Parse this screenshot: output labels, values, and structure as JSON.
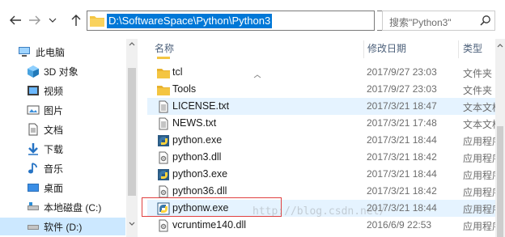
{
  "address": {
    "path": "D:\\SoftwareSpace\\Python\\Python3",
    "search_placeholder": "搜索\"Python3\""
  },
  "navigation": {
    "items": [
      {
        "label": "此电脑",
        "icon": "pc-icon"
      },
      {
        "label": "3D 对象",
        "icon": "3d-objects-icon"
      },
      {
        "label": "视频",
        "icon": "video-icon"
      },
      {
        "label": "图片",
        "icon": "pictures-icon"
      },
      {
        "label": "文档",
        "icon": "documents-icon"
      },
      {
        "label": "下载",
        "icon": "download-icon"
      },
      {
        "label": "音乐",
        "icon": "music-icon"
      },
      {
        "label": "桌面",
        "icon": "desktop-icon"
      },
      {
        "label": "本地磁盘 (C:)",
        "icon": "drive-icon"
      },
      {
        "label": "软件 (D:)",
        "icon": "drive-icon"
      }
    ]
  },
  "columns": {
    "name": "名称",
    "date": "修改日期",
    "type": "类型"
  },
  "files": [
    {
      "name": "",
      "date": "",
      "type": "",
      "icon": "folder-icon"
    },
    {
      "name": "tcl",
      "date": "2017/9/27 23:03",
      "type": "文件夹",
      "icon": "folder-icon"
    },
    {
      "name": "Tools",
      "date": "2017/9/27 23:03",
      "type": "文件夹",
      "icon": "folder-icon"
    },
    {
      "name": "LICENSE.txt",
      "date": "2017/3/21 18:47",
      "type": "文本文档",
      "icon": "text-file-icon"
    },
    {
      "name": "NEWS.txt",
      "date": "2017/3/21 17:48",
      "type": "文本文档",
      "icon": "text-file-icon"
    },
    {
      "name": "python.exe",
      "date": "2017/3/21 18:44",
      "type": "应用程序",
      "icon": "python-exe-icon"
    },
    {
      "name": "python3.dll",
      "date": "2017/3/21 18:42",
      "type": "应用程序",
      "icon": "dll-icon"
    },
    {
      "name": "python3.exe",
      "date": "2017/3/21 18:44",
      "type": "应用程序",
      "icon": "python-exe-icon"
    },
    {
      "name": "python36.dll",
      "date": "2017/3/21 18:42",
      "type": "应用程序",
      "icon": "dll-icon"
    },
    {
      "name": "pythonw.exe",
      "date": "2017/3/21 18:44",
      "type": "应用程序",
      "icon": "pythonw-exe-icon"
    },
    {
      "name": "vcruntime140.dll",
      "date": "2016/6/9 22:53",
      "type": "应用程序",
      "icon": "dll-icon"
    }
  ],
  "watermark": "http://blog.csdn.net/",
  "colors": {
    "selection": "#0078d7",
    "hover_row": "#e5f3ff",
    "nav_selected": "#cce8ff",
    "highlight_box": "#e04040",
    "folder": "#f4c542"
  }
}
